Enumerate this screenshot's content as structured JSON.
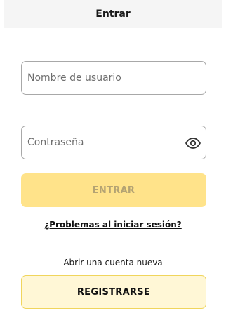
{
  "header": {
    "title": "Entrar"
  },
  "form": {
    "username_placeholder": "Nombre de usuario",
    "username_value": "",
    "password_placeholder": "Contraseña",
    "password_value": "",
    "toggle_icon": "eye-icon",
    "submit_label": "ENTRAR",
    "trouble_link": "¿Problemas al iniciar sesión?"
  },
  "register": {
    "prompt": "Abrir una cuenta nueva",
    "button_label": "REGISTRARSE"
  },
  "colors": {
    "primary_button": "#ffe38a",
    "secondary_button": "#fff7d6",
    "secondary_border": "#f0d55c",
    "header_bg": "#f5f5f5"
  }
}
